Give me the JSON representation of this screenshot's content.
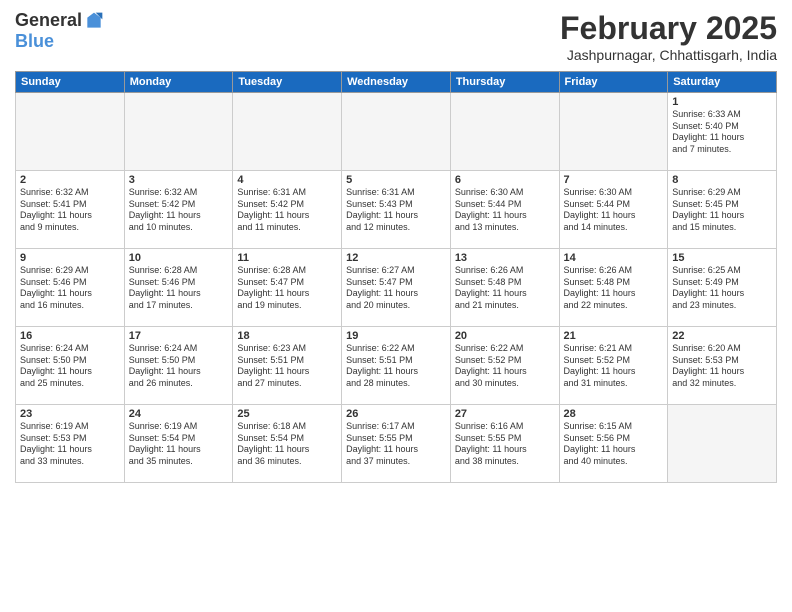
{
  "header": {
    "logo": {
      "general": "General",
      "blue": "Blue"
    },
    "title": "February 2025",
    "location": "Jashpurnagar, Chhattisgarh, India"
  },
  "weekdays": [
    "Sunday",
    "Monday",
    "Tuesday",
    "Wednesday",
    "Thursday",
    "Friday",
    "Saturday"
  ],
  "weeks": [
    [
      {
        "day": "",
        "empty": true
      },
      {
        "day": "",
        "empty": true
      },
      {
        "day": "",
        "empty": true
      },
      {
        "day": "",
        "empty": true
      },
      {
        "day": "",
        "empty": true
      },
      {
        "day": "",
        "empty": true
      },
      {
        "day": "1",
        "info": "Sunrise: 6:33 AM\nSunset: 5:40 PM\nDaylight: 11 hours\nand 7 minutes."
      }
    ],
    [
      {
        "day": "2",
        "info": "Sunrise: 6:32 AM\nSunset: 5:41 PM\nDaylight: 11 hours\nand 9 minutes."
      },
      {
        "day": "3",
        "info": "Sunrise: 6:32 AM\nSunset: 5:42 PM\nDaylight: 11 hours\nand 10 minutes."
      },
      {
        "day": "4",
        "info": "Sunrise: 6:31 AM\nSunset: 5:42 PM\nDaylight: 11 hours\nand 11 minutes."
      },
      {
        "day": "5",
        "info": "Sunrise: 6:31 AM\nSunset: 5:43 PM\nDaylight: 11 hours\nand 12 minutes."
      },
      {
        "day": "6",
        "info": "Sunrise: 6:30 AM\nSunset: 5:44 PM\nDaylight: 11 hours\nand 13 minutes."
      },
      {
        "day": "7",
        "info": "Sunrise: 6:30 AM\nSunset: 5:44 PM\nDaylight: 11 hours\nand 14 minutes."
      },
      {
        "day": "8",
        "info": "Sunrise: 6:29 AM\nSunset: 5:45 PM\nDaylight: 11 hours\nand 15 minutes."
      }
    ],
    [
      {
        "day": "9",
        "info": "Sunrise: 6:29 AM\nSunset: 5:46 PM\nDaylight: 11 hours\nand 16 minutes."
      },
      {
        "day": "10",
        "info": "Sunrise: 6:28 AM\nSunset: 5:46 PM\nDaylight: 11 hours\nand 17 minutes."
      },
      {
        "day": "11",
        "info": "Sunrise: 6:28 AM\nSunset: 5:47 PM\nDaylight: 11 hours\nand 19 minutes."
      },
      {
        "day": "12",
        "info": "Sunrise: 6:27 AM\nSunset: 5:47 PM\nDaylight: 11 hours\nand 20 minutes."
      },
      {
        "day": "13",
        "info": "Sunrise: 6:26 AM\nSunset: 5:48 PM\nDaylight: 11 hours\nand 21 minutes."
      },
      {
        "day": "14",
        "info": "Sunrise: 6:26 AM\nSunset: 5:48 PM\nDaylight: 11 hours\nand 22 minutes."
      },
      {
        "day": "15",
        "info": "Sunrise: 6:25 AM\nSunset: 5:49 PM\nDaylight: 11 hours\nand 23 minutes."
      }
    ],
    [
      {
        "day": "16",
        "info": "Sunrise: 6:24 AM\nSunset: 5:50 PM\nDaylight: 11 hours\nand 25 minutes."
      },
      {
        "day": "17",
        "info": "Sunrise: 6:24 AM\nSunset: 5:50 PM\nDaylight: 11 hours\nand 26 minutes."
      },
      {
        "day": "18",
        "info": "Sunrise: 6:23 AM\nSunset: 5:51 PM\nDaylight: 11 hours\nand 27 minutes."
      },
      {
        "day": "19",
        "info": "Sunrise: 6:22 AM\nSunset: 5:51 PM\nDaylight: 11 hours\nand 28 minutes."
      },
      {
        "day": "20",
        "info": "Sunrise: 6:22 AM\nSunset: 5:52 PM\nDaylight: 11 hours\nand 30 minutes."
      },
      {
        "day": "21",
        "info": "Sunrise: 6:21 AM\nSunset: 5:52 PM\nDaylight: 11 hours\nand 31 minutes."
      },
      {
        "day": "22",
        "info": "Sunrise: 6:20 AM\nSunset: 5:53 PM\nDaylight: 11 hours\nand 32 minutes."
      }
    ],
    [
      {
        "day": "23",
        "info": "Sunrise: 6:19 AM\nSunset: 5:53 PM\nDaylight: 11 hours\nand 33 minutes."
      },
      {
        "day": "24",
        "info": "Sunrise: 6:19 AM\nSunset: 5:54 PM\nDaylight: 11 hours\nand 35 minutes."
      },
      {
        "day": "25",
        "info": "Sunrise: 6:18 AM\nSunset: 5:54 PM\nDaylight: 11 hours\nand 36 minutes."
      },
      {
        "day": "26",
        "info": "Sunrise: 6:17 AM\nSunset: 5:55 PM\nDaylight: 11 hours\nand 37 minutes."
      },
      {
        "day": "27",
        "info": "Sunrise: 6:16 AM\nSunset: 5:55 PM\nDaylight: 11 hours\nand 38 minutes."
      },
      {
        "day": "28",
        "info": "Sunrise: 6:15 AM\nSunset: 5:56 PM\nDaylight: 11 hours\nand 40 minutes."
      },
      {
        "day": "",
        "empty": true
      }
    ]
  ]
}
